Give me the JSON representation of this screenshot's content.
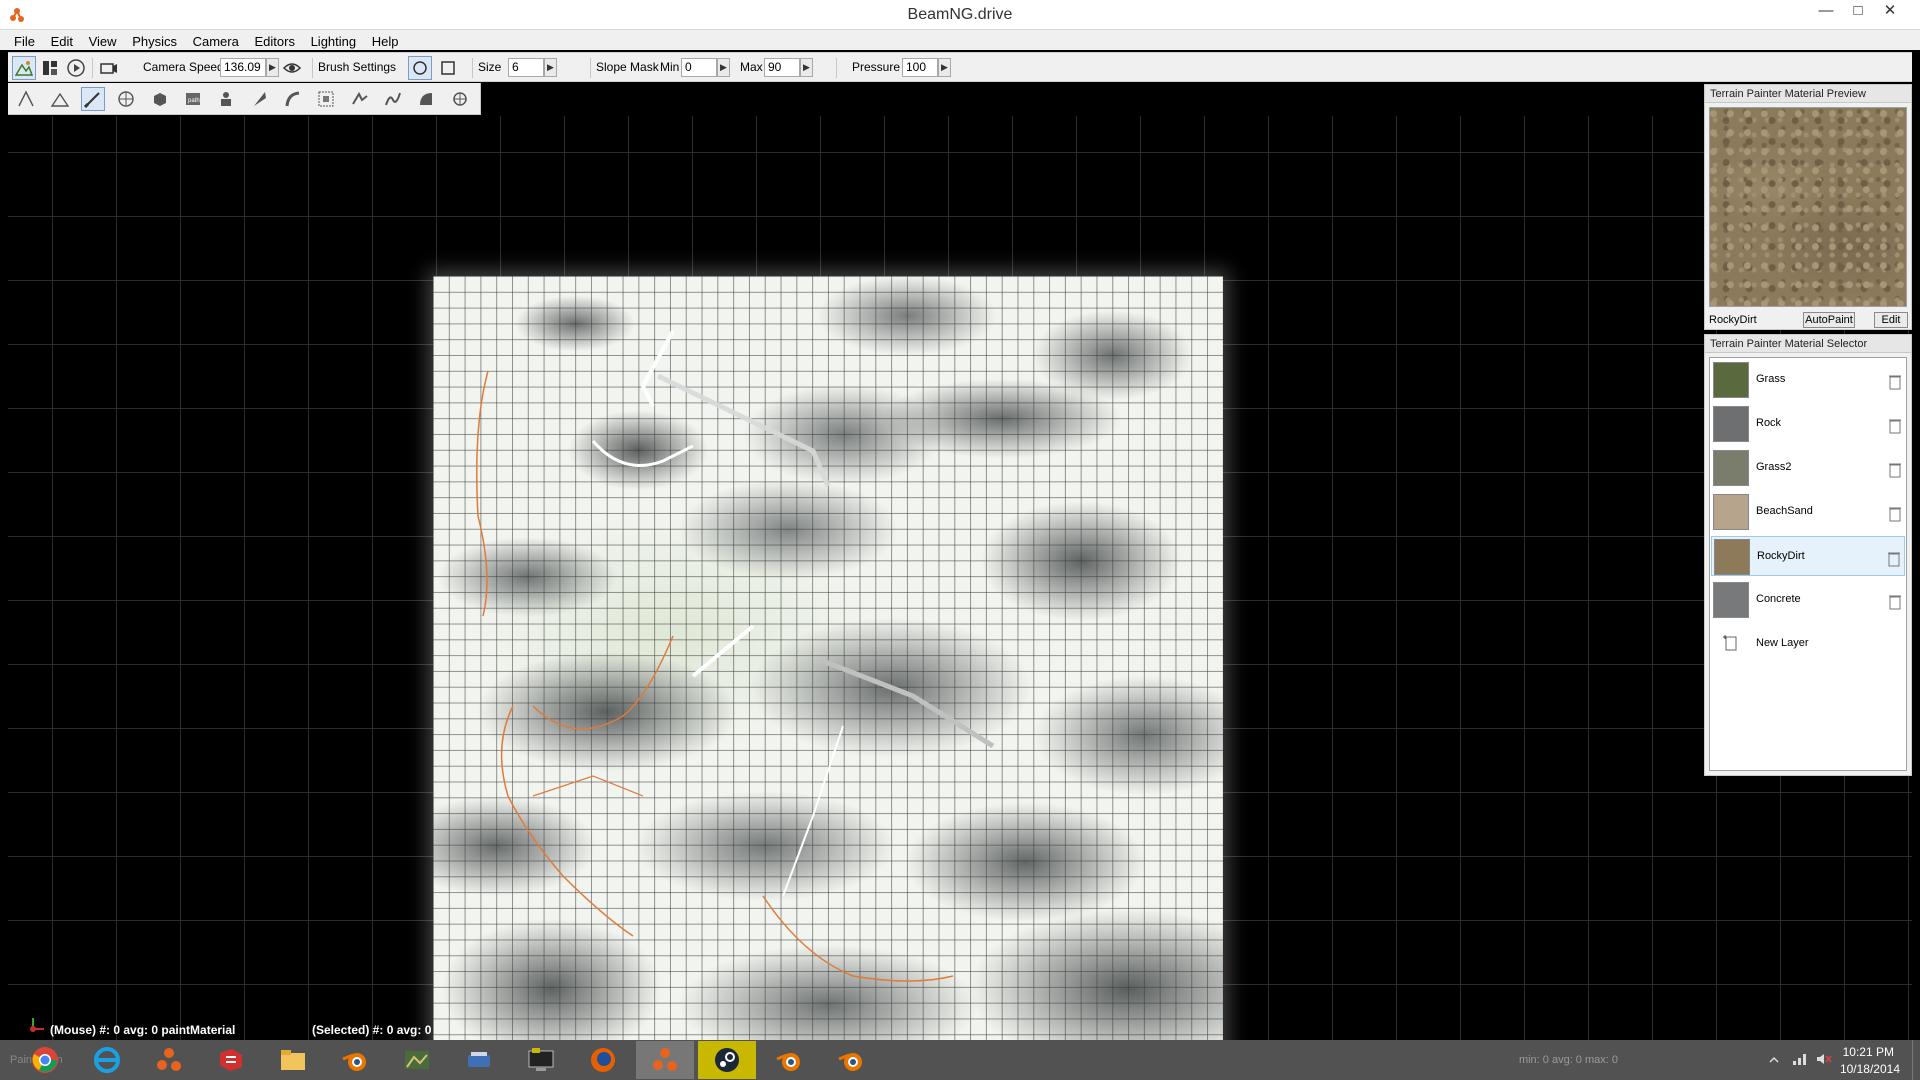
{
  "window": {
    "title": "BeamNG.drive",
    "minimize": "—",
    "maximize": "□",
    "close": "✕"
  },
  "menu": [
    "File",
    "Edit",
    "View",
    "Physics",
    "Camera",
    "Editors",
    "Lighting",
    "Help"
  ],
  "toolbar": {
    "camera_speed_label": "Camera Speed",
    "camera_speed_value": "136.09",
    "brush_settings_label": "Brush Settings",
    "size_label": "Size",
    "size_value": "6",
    "slope_mask_label": "Slope Mask",
    "min_label": "Min",
    "min_value": "0",
    "max_label": "Max",
    "max_value": "90",
    "pressure_label": "Pressure",
    "pressure_value": "100"
  },
  "status": {
    "mouse": "(Mouse) #: 0  avg: 0 paintMaterial",
    "selected": "(Selected) #: 0  avg: 0"
  },
  "preview_panel": {
    "title": "Terrain Painter Material Preview",
    "material_name": "RockyDirt",
    "autopaint_label": "AutoPaint",
    "edit_label": "Edit"
  },
  "selector_panel": {
    "title": "Terrain Painter Material Selector",
    "materials": [
      {
        "name": "Grass",
        "color": "#5b6a3e"
      },
      {
        "name": "Rock",
        "color": "#6d6f70"
      },
      {
        "name": "Grass2",
        "color": "#7a7c6c"
      },
      {
        "name": "BeachSand",
        "color": "#b6a58c"
      },
      {
        "name": "RockyDirt",
        "color": "#8d7a5a"
      },
      {
        "name": "Concrete",
        "color": "#77797a"
      }
    ],
    "selected_index": 4,
    "new_layer_label": "New Layer"
  },
  "taskbar": {
    "tray_text": "min: 0  avg: 0  max: 0",
    "time": "10:21 PM",
    "date": "10/18/2014",
    "search_ghost": "Paint ... on",
    "apps": [
      "chrome-icon",
      "ie-icon",
      "beamng-icon",
      "sketchup-icon",
      "explorer-icon",
      "blender-icon",
      "game-icon",
      "scanner-icon",
      "terminal-icon",
      "firefox-icon",
      "beamng-icon",
      "steam-icon",
      "blender-icon",
      "blender-icon"
    ]
  }
}
